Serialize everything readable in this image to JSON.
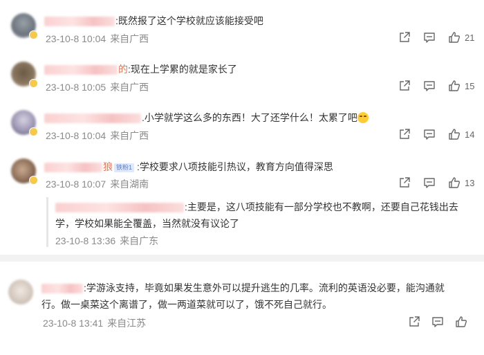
{
  "comments": [
    {
      "name_tail": "",
      "text": ":既然报了这个学校就应该能接受吧",
      "time": "23-10-8 10:04",
      "location": "来自广西",
      "likes": "21"
    },
    {
      "name_tail": "的",
      "text": ":现在上学累的就是家长了",
      "time": "23-10-8 10:05",
      "location": "来自广西",
      "likes": "15"
    },
    {
      "name_tail": "",
      "text": ".小学就学这么多的东西！大了还学什么！太累了吧",
      "time": "23-10-8 10:04",
      "location": "来自广西",
      "likes": "14"
    },
    {
      "name_tail": "狼",
      "badge": "铁粉1",
      "text": ":学校要求八项技能引热议，教育方向值得深思",
      "time": "23-10-8 10:07",
      "location": "来自湖南",
      "likes": "13"
    }
  ],
  "reply": {
    "text_line1": ":主要是，这八项技能有一部分学校也不教啊，还要自己花钱出去",
    "text_line2": "学，学校如果能全覆盖，当然就没有议论了",
    "time": "23-10-8 13:36",
    "location": "来自广东"
  },
  "last_comment": {
    "text_line1": ":学游泳支持，毕竟如果发生意外可以提升逃生的几率。流利的英语没必要，能沟通就",
    "text_line2": "行。做一桌菜这个离谱了，做一两道菜就可以了，饿不死自己就行。",
    "time": "23-10-8 13:41",
    "location": "来自江苏"
  },
  "icons": {
    "share": "share-icon",
    "comment": "comment-icon",
    "like": "thumbs-up-icon"
  }
}
